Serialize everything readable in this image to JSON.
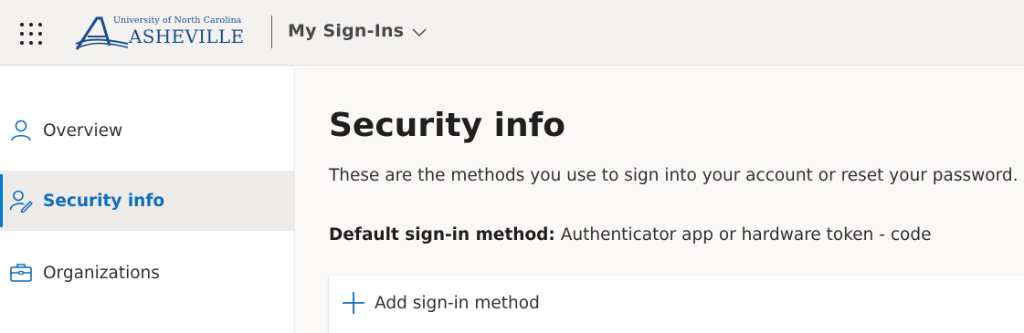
{
  "header": {
    "waffle_icon": "app-launcher-icon",
    "logo": {
      "line1": "University of North Carolina",
      "line2": "ASHEVILLE"
    },
    "app_name": "My Sign-Ins"
  },
  "sidebar": {
    "items": [
      {
        "label": "Overview",
        "icon": "person-icon",
        "active": false
      },
      {
        "label": "Security info",
        "icon": "person-edit-icon",
        "active": true
      },
      {
        "label": "Organizations",
        "icon": "briefcase-icon",
        "active": false
      }
    ]
  },
  "main": {
    "title": "Security info",
    "description": "These are the methods you use to sign into your account or reset your password.",
    "default_method_label": "Default sign-in method:",
    "default_method_value": "Authenticator app or hardware token - code",
    "add_method_label": "Add sign-in method"
  },
  "colors": {
    "accent": "#0078d4",
    "brand_blue": "#1b4e8a",
    "active_text": "#0f6cbd"
  }
}
